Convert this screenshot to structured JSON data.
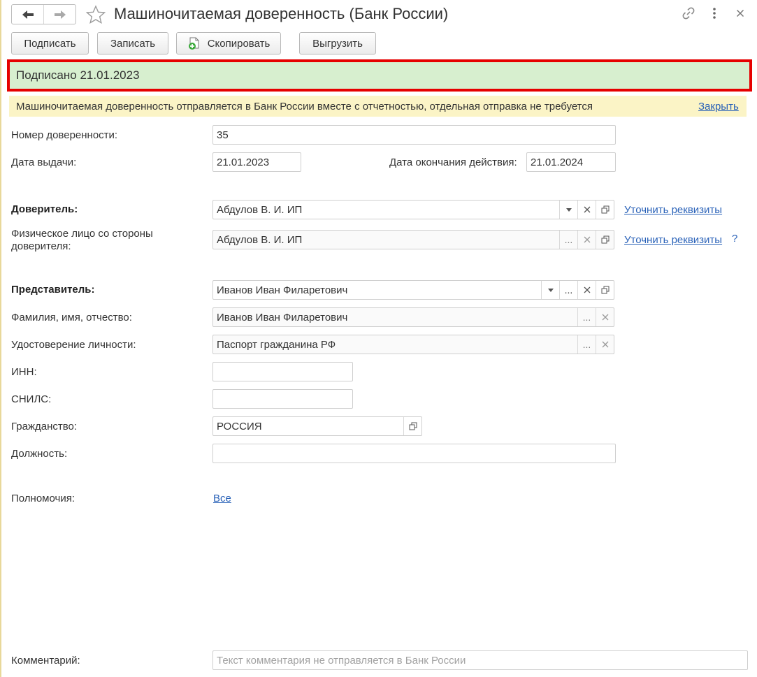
{
  "window": {
    "title": "Машиночитаемая доверенность (Банк России)",
    "icons": [
      "arrow-left-icon",
      "arrow-right-icon",
      "star-icon",
      "link-icon",
      "more-icon",
      "close-icon"
    ]
  },
  "toolbar": {
    "sign_label": "Подписать",
    "save_label": "Записать",
    "copy_label": "Скопировать",
    "export_label": "Выгрузить"
  },
  "status": {
    "signed_text": "Подписано 21.01.2023",
    "info_text": "Машиночитаемая доверенность отправляется в Банк России вместе с отчетностью, отдельная отправка не требуется",
    "close_link": "Закрыть"
  },
  "form": {
    "number_label": "Номер доверенности:",
    "number_value": "35",
    "issue_date_label": "Дата выдачи:",
    "issue_date_value": "21.01.2023",
    "end_date_label": "Дата окончания действия:",
    "end_date_value": "21.01.2024",
    "principal_label": "Доверитель:",
    "principal_value": "Абдулов В. И. ИП",
    "principal_link": "Уточнить реквизиты",
    "principal_person_label": "Физическое лицо со стороны доверителя:",
    "principal_person_value": "Абдулов В. И. ИП",
    "principal_person_link": "Уточнить реквизиты",
    "help_mark": "?",
    "representative_label": "Представитель:",
    "representative_value": "Иванов Иван Филаретович",
    "fio_label": "Фамилия, имя, отчество:",
    "fio_value": "Иванов Иван Филаретович",
    "id_doc_label": "Удостоверение личности:",
    "id_doc_value": "Паспорт гражданина РФ",
    "inn_label": "ИНН:",
    "inn_value": "",
    "snils_label": "СНИЛС:",
    "snils_value": "",
    "citizenship_label": "Гражданство:",
    "citizenship_value": "РОССИЯ",
    "position_label": "Должность:",
    "position_value": "",
    "powers_label": "Полномочия:",
    "powers_link": "Все",
    "comment_label": "Комментарий:",
    "comment_placeholder": "Текст комментария не отправляется в Банк России"
  },
  "colors": {
    "signed_bg": "#d7efcf",
    "signed_border": "#e60000",
    "info_bg": "#fbf4c6",
    "link": "#2a62b8"
  }
}
